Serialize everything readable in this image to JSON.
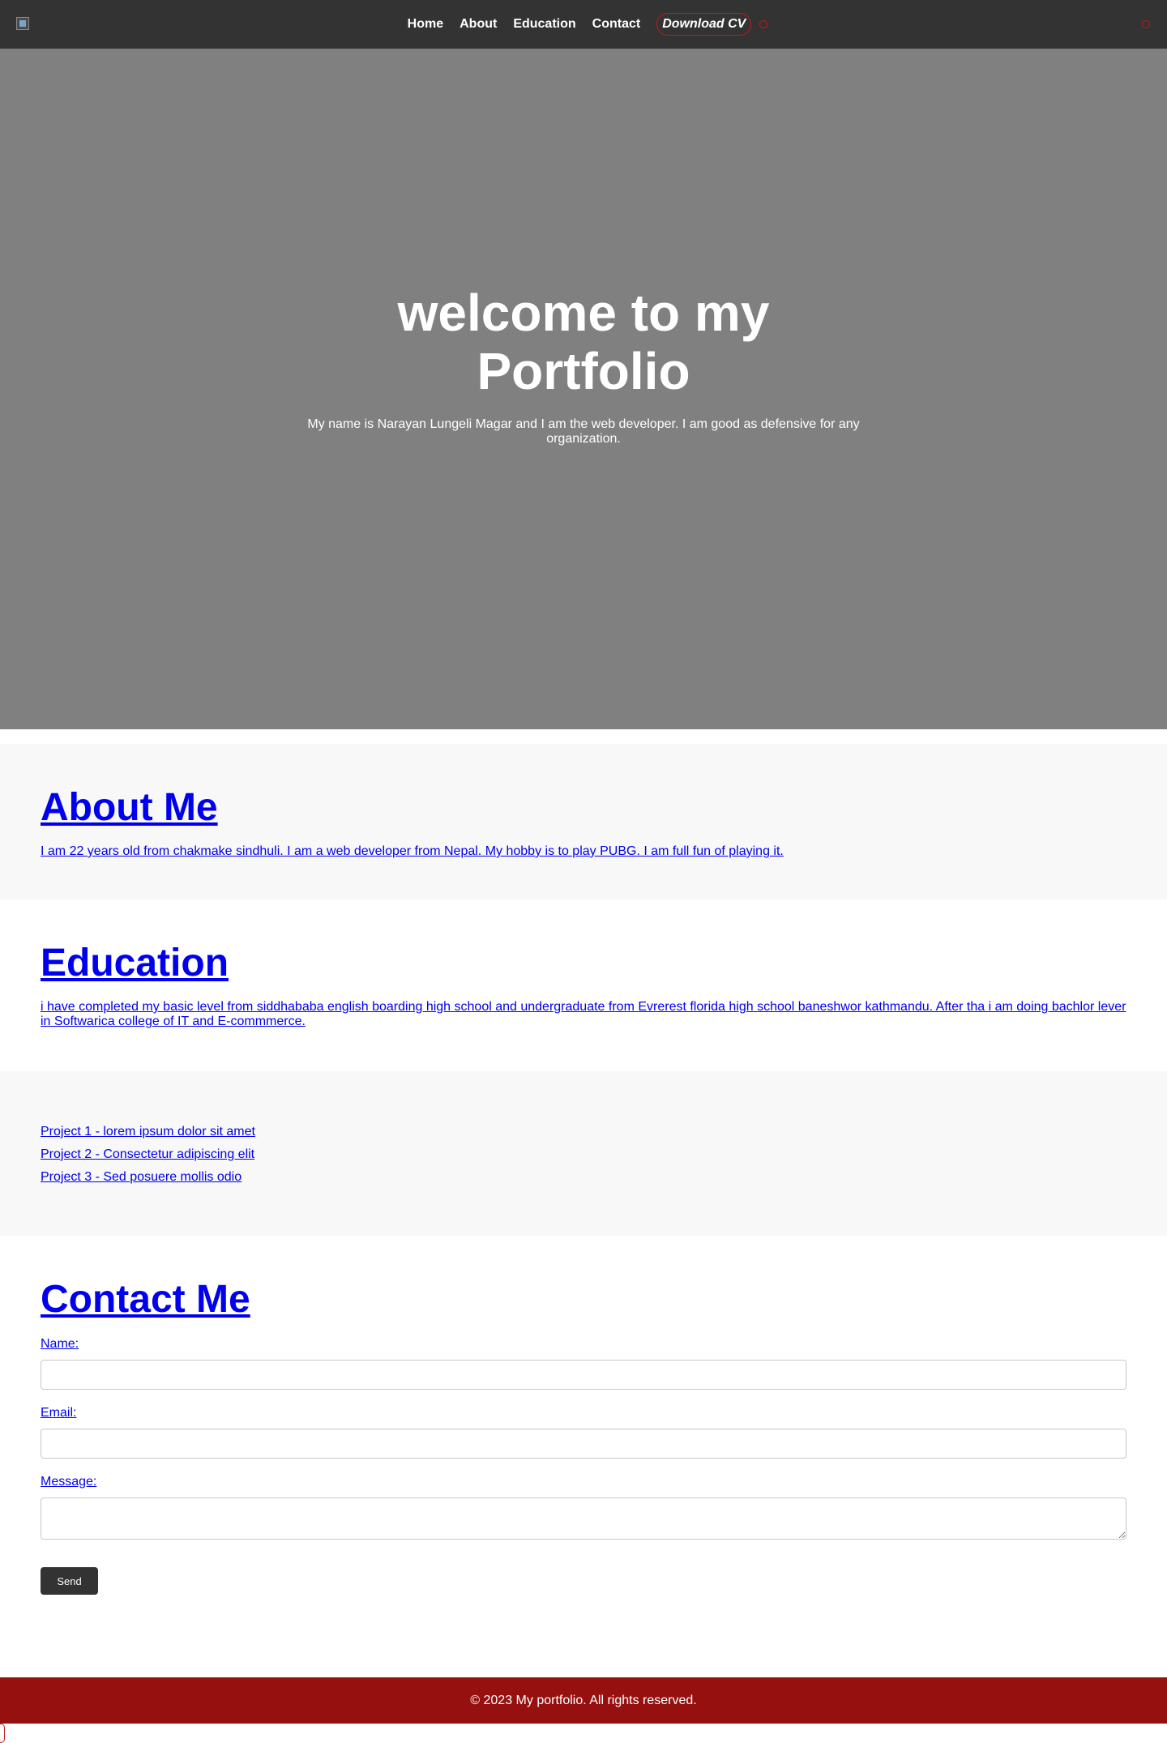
{
  "navbar": {
    "links": [
      "Home",
      "About",
      "Education",
      "Contact"
    ],
    "cv_label": "Download CV"
  },
  "hero": {
    "title": "welcome to my Portfolio",
    "text": "My name is Narayan Lungeli Magar and I am the web developer. I am good as defensive for any organization."
  },
  "about": {
    "title": "About Me",
    "text": "I am 22 years old from chakmake sindhuli. I am a web developer from Nepal. My hobby is to play PUBG. I am full fun of playing it."
  },
  "education": {
    "title": "Education",
    "text": "i have completed my basic level from siddhababa english boarding high school and undergraduate from Evrerest florida high school baneshwor kathmandu. After tha i am doing bachlor lever in Softwarica college of IT and E-commmerce."
  },
  "projects": {
    "items": [
      "Project 1 - lorem ipsum dolor sit amet",
      "Project 2 - Consectetur adipiscing elit",
      "Project 3 - Sed posuere mollis odio"
    ]
  },
  "contact": {
    "title": "Contact Me",
    "name_label": "Name:",
    "email_label": "Email:",
    "message_label": "Message:",
    "send_label": "Send"
  },
  "footer": {
    "text": "© 2023 My portfolio. All rights reserved."
  },
  "colors": {
    "navbar_bg": "#333333",
    "hero_bg": "#808080",
    "link": "#0000ee",
    "footer_bg": "#961010",
    "accent_red": "#c21a1a"
  }
}
